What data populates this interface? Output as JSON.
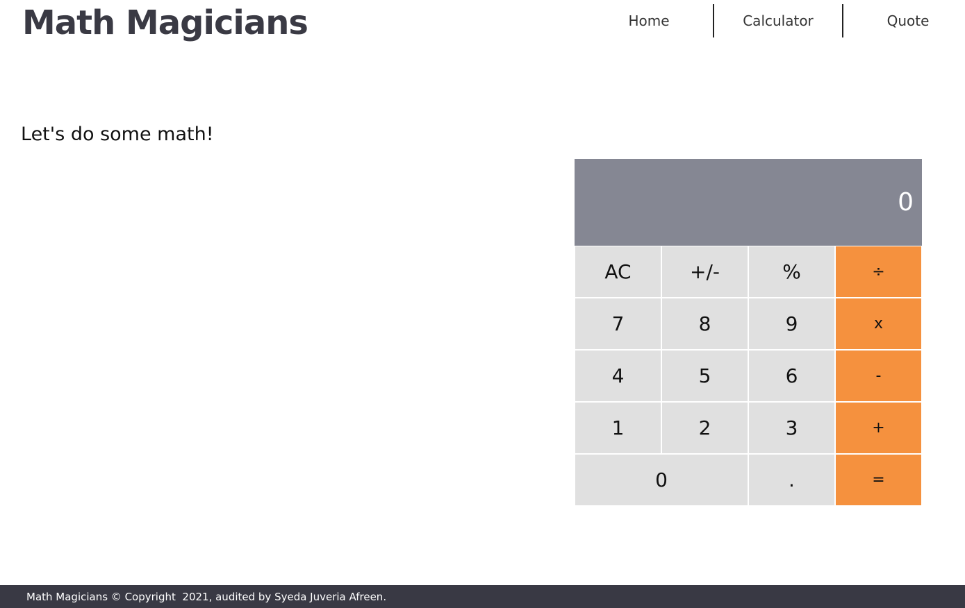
{
  "header": {
    "brand": "Math Magicians",
    "nav": [
      {
        "label": "Home"
      },
      {
        "label": "Calculator"
      },
      {
        "label": "Quote"
      }
    ]
  },
  "main": {
    "intro": "Let's do some math!"
  },
  "calculator": {
    "display": "0",
    "keys": {
      "ac": "AC",
      "sign": "+/-",
      "percent": "%",
      "divide": "÷",
      "seven": "7",
      "eight": "8",
      "nine": "9",
      "multiply": "x",
      "four": "4",
      "five": "5",
      "six": "6",
      "minus": "-",
      "one": "1",
      "two": "2",
      "three": "3",
      "plus": "+",
      "zero": "0",
      "dot": ".",
      "equals": "="
    },
    "colors": {
      "display_bg": "#858793",
      "key_bg": "#e0e0e0",
      "operator_bg": "#f5913e"
    }
  },
  "footer": {
    "text": "Math Magicians © Copyright  2021, audited by Syeda Juveria Afreen."
  }
}
